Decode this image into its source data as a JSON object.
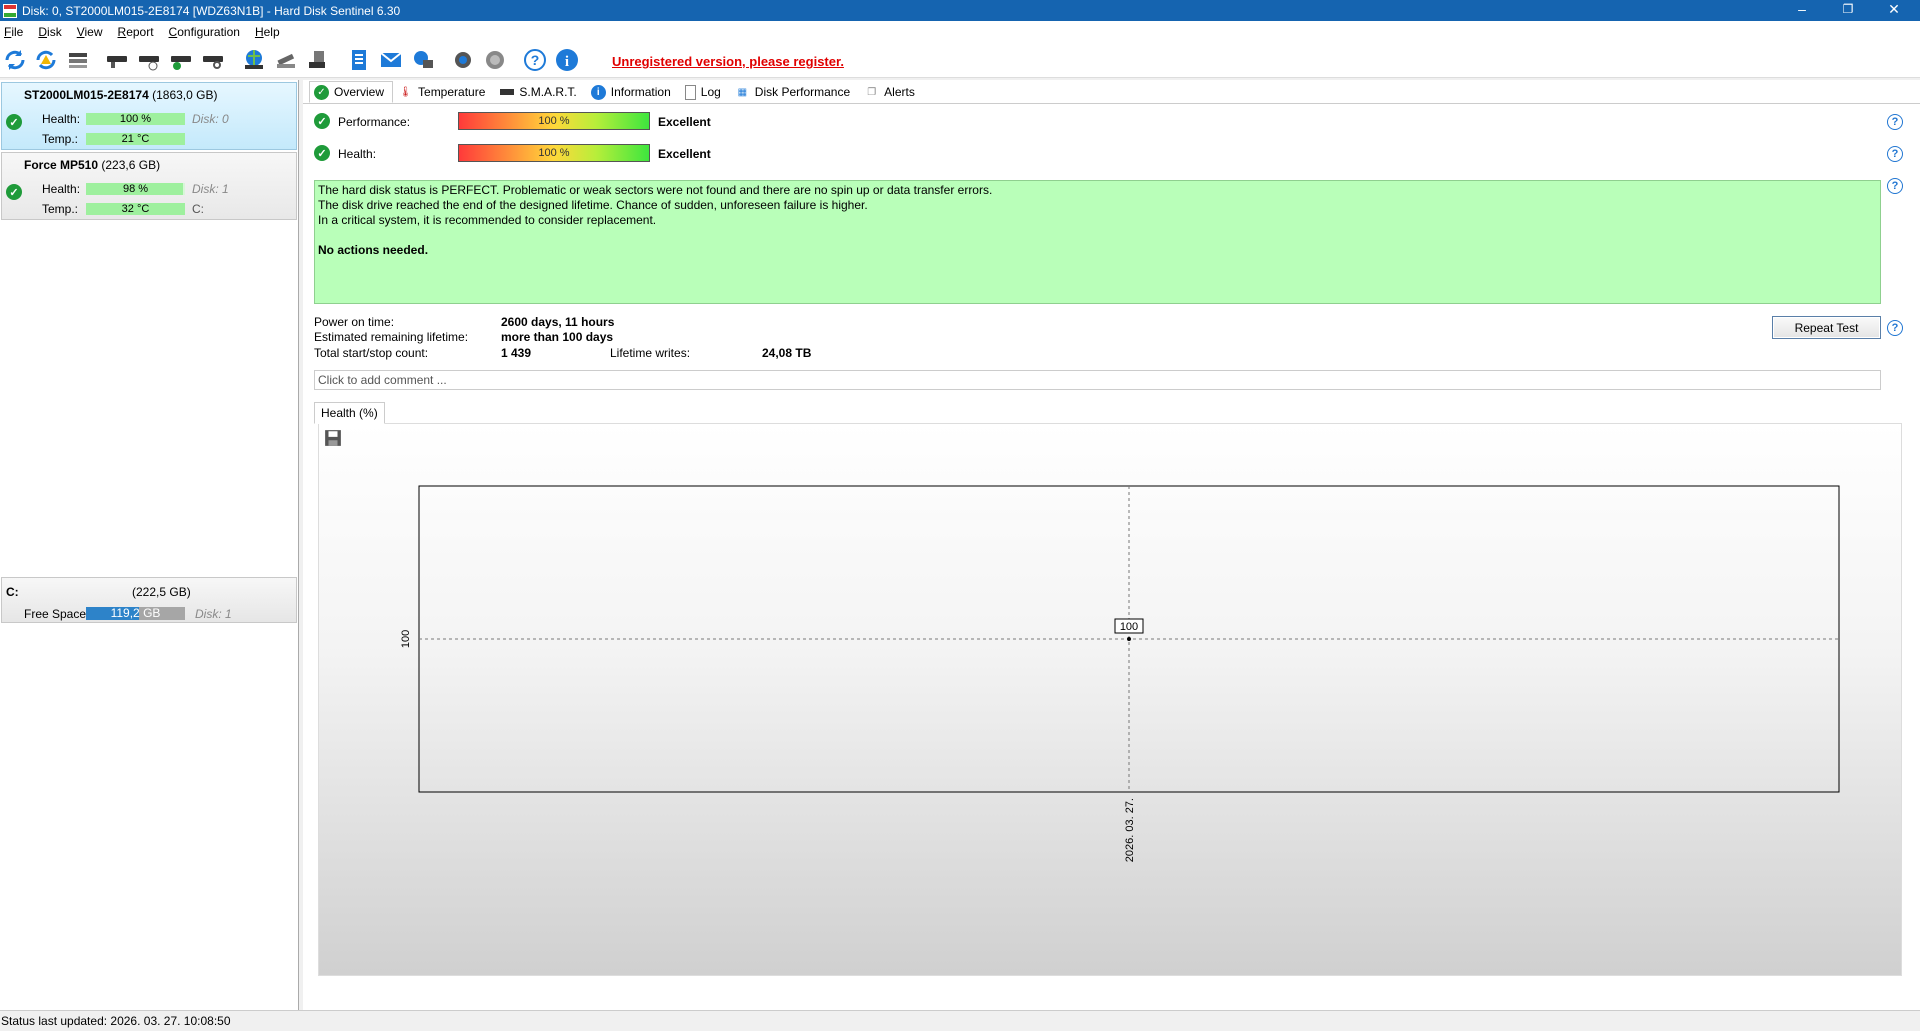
{
  "window": {
    "title": "Disk: 0, ST2000LM015-2E8174 [WDZ63N1B]  -  Hard Disk Sentinel 6.30",
    "controls": [
      "–",
      "❐",
      "✕"
    ]
  },
  "menu": [
    "File",
    "Disk",
    "View",
    "Report",
    "Configuration",
    "Help"
  ],
  "toolbar": {
    "icons": [
      "refresh-icon",
      "refresh-warning-icon",
      "disk-list-icon",
      "disk-icon",
      "disk-schedule-icon",
      "disk-check-icon",
      "disk-search-icon",
      "globe-disk-icon",
      "satellite-icon",
      "backup-icon",
      "report-icon",
      "email-icon",
      "network-icon",
      "settings-icon",
      "options-icon",
      "help-icon",
      "info-icon"
    ],
    "register_text": "Unregistered version, please register."
  },
  "disks": [
    {
      "name": "ST2000LM015-2E8174",
      "size": "(1863,0 GB)",
      "health_label": "Health:",
      "health": "100 %",
      "health_value": 100,
      "disk": "Disk: 0",
      "temp_label": "Temp.:",
      "temp": "21 °C",
      "temp_aux": ""
    },
    {
      "name": "Force MP510",
      "size": "(223,6 GB)",
      "health_label": "Health:",
      "health": "98 %",
      "health_value": 98,
      "disk": "Disk: 1",
      "temp_label": "Temp.:",
      "temp": "32 °C",
      "temp_aux": "C:"
    }
  ],
  "volume": {
    "name": "C:",
    "size": "(222,5 GB)",
    "free_label": "Free Space",
    "free": "119,2 GB",
    "free_fraction": 0.536,
    "disk": "Disk: 1"
  },
  "tabs": [
    "Overview",
    "Temperature",
    "S.M.A.R.T.",
    "Information",
    "Log",
    "Disk Performance",
    "Alerts"
  ],
  "overview": {
    "performance_label": "Performance:",
    "performance_value": "100 %",
    "performance_rating": "Excellent",
    "health_label": "Health:",
    "health_value": "100 %",
    "health_rating": "Excellent",
    "status_lines": [
      "The hard disk status is PERFECT. Problematic or weak sectors were not found and there are no spin up or data transfer errors.",
      "The disk drive reached the end of the designed lifetime. Chance of sudden, unforeseen failure is higher.",
      "In a critical system, it is recommended to consider replacement."
    ],
    "status_action": "No actions needed.",
    "power_on_label": "Power on time:",
    "power_on": "2600 days, 11 hours",
    "remaining_label": "Estimated remaining lifetime:",
    "remaining": "more than 100 days",
    "startstop_label": "Total start/stop count:",
    "startstop": "1 439",
    "writes_label": "Lifetime writes:",
    "writes": "24,08 TB",
    "repeat_button": "Repeat Test",
    "comment_placeholder": "Click to add comment ..."
  },
  "chart_tab": "Health (%)",
  "chart_data": {
    "type": "line",
    "x": [
      "2026. 03. 27."
    ],
    "series": [
      {
        "values": [
          100
        ]
      }
    ],
    "data_labels": [
      "100"
    ],
    "y_tick_labels": [
      "100"
    ],
    "x_tick_labels": [
      "2026. 03. 27."
    ],
    "title": "",
    "xlabel": "",
    "ylabel": "",
    "grid": "dashed crosshair"
  },
  "statusbar": {
    "text": "Status last updated: 2026. 03. 27. 10:08:50"
  }
}
